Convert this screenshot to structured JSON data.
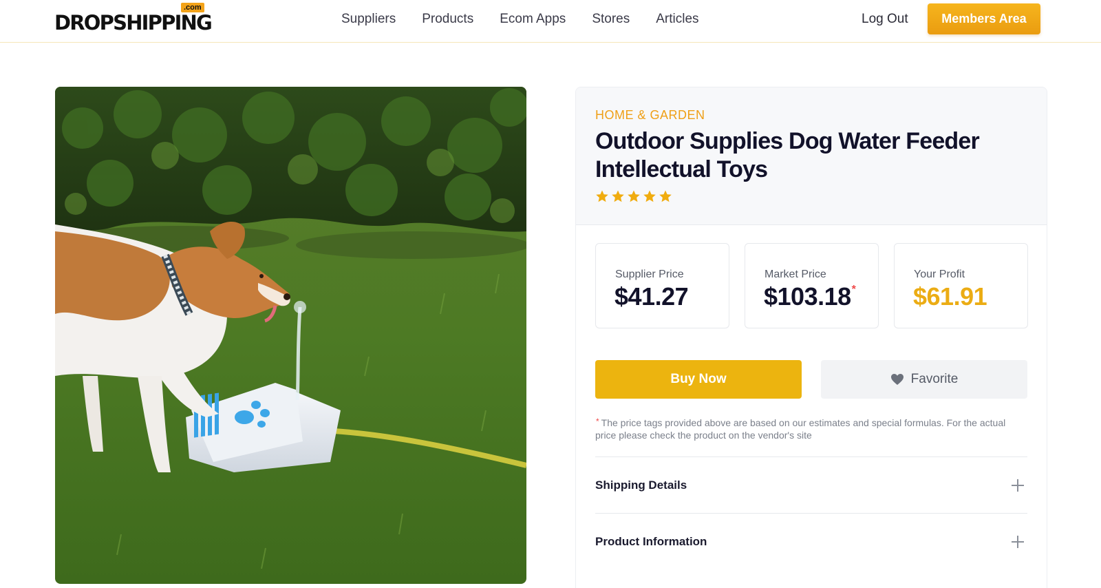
{
  "brand": {
    "name": "DROPSHIPPING",
    "tld": ".com",
    "accent": "#f3a319"
  },
  "nav": {
    "items": [
      {
        "label": "Suppliers"
      },
      {
        "label": "Products"
      },
      {
        "label": "Ecom Apps"
      },
      {
        "label": "Stores"
      },
      {
        "label": "Articles"
      }
    ],
    "logout_label": "Log Out",
    "members_label": "Members Area"
  },
  "product": {
    "image_alt_icon": "product-photo",
    "category": "HOME & GARDEN",
    "title": "Outdoor Supplies Dog Water Feeder Intellectual Toys",
    "rating": 5,
    "rating_max": 5,
    "prices": {
      "supplier": {
        "label": "Supplier Price",
        "value": "$41.27"
      },
      "market": {
        "label": "Market Price",
        "value": "$103.18",
        "asterisk": "*"
      },
      "profit": {
        "label": "Your Profit",
        "value": "$61.91"
      }
    },
    "buy_label": "Buy Now",
    "favorite_label": "Favorite",
    "disclaimer_mark": "*",
    "disclaimer": "The price tags provided above are based on our estimates and special formulas. For the actual price please check the product on the vendor's site",
    "accordions": [
      {
        "label": "Shipping Details"
      },
      {
        "label": "Product Information"
      }
    ]
  },
  "colors": {
    "accent": "#ecb40f",
    "profit": "#ebac14",
    "asterisk": "#ef4848",
    "text": "#12122a"
  }
}
